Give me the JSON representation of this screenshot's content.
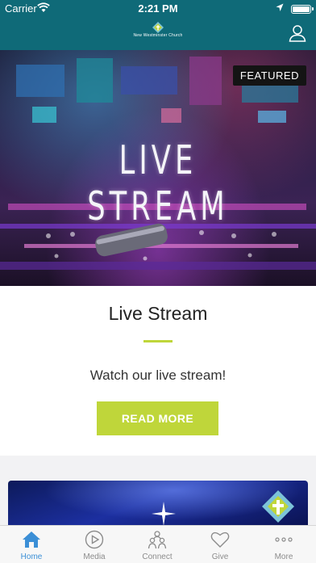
{
  "status_bar": {
    "carrier": "Carrier",
    "time": "2:21 PM"
  },
  "header": {
    "logo_text": "New Westminster Church"
  },
  "featured_card": {
    "badge": "FEATURED",
    "image_text": "LIVE STREAM",
    "title": "Live Stream",
    "description": "Watch our live stream!",
    "button_label": "READ MORE"
  },
  "tab_bar": {
    "active": "Home",
    "items": [
      {
        "label": "Home",
        "icon": "home-icon"
      },
      {
        "label": "Media",
        "icon": "play-icon"
      },
      {
        "label": "Connect",
        "icon": "people-icon"
      },
      {
        "label": "Give",
        "icon": "heart-icon"
      },
      {
        "label": "More",
        "icon": "more-dots-icon"
      }
    ]
  },
  "colors": {
    "header_bg": "#0f6a78",
    "accent": "#bfd63a",
    "tab_active": "#3b8fd6",
    "tab_inactive": "#8c8c8c"
  }
}
